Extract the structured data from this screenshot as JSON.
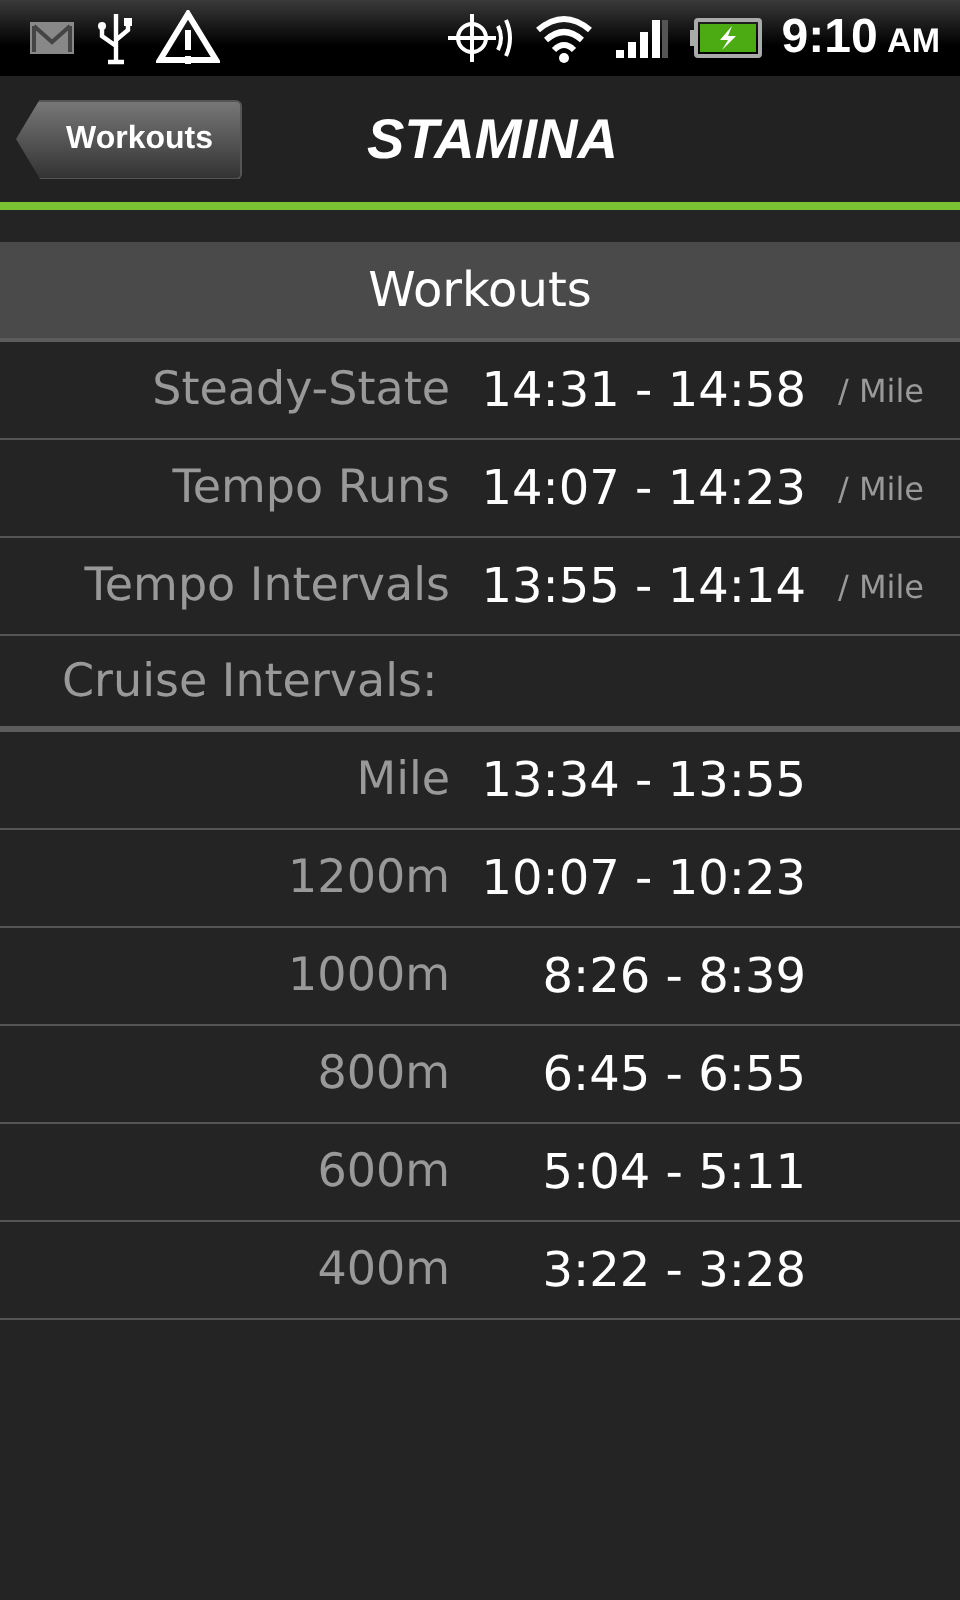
{
  "status_bar": {
    "time": "9:10",
    "ampm": "AM"
  },
  "header": {
    "back_button": "Workouts",
    "title": "STAMINA"
  },
  "section": {
    "title": "Workouts"
  },
  "rows": [
    {
      "kind": "pace",
      "label": "Steady-State",
      "value": "14:31 - 14:58",
      "unit": "/ Mile"
    },
    {
      "kind": "pace",
      "label": "Tempo Runs",
      "value": "14:07 - 14:23",
      "unit": "/ Mile"
    },
    {
      "kind": "pace",
      "label": "Tempo Intervals",
      "value": "13:55 - 14:14",
      "unit": "/ Mile"
    },
    {
      "kind": "heading",
      "label": "Cruise Intervals:"
    },
    {
      "kind": "interval",
      "label": "Mile",
      "value": "13:34 - 13:55"
    },
    {
      "kind": "interval",
      "label": "1200m",
      "value": "10:07 - 10:23"
    },
    {
      "kind": "interval",
      "label": "1000m",
      "value": "8:26 - 8:39"
    },
    {
      "kind": "interval",
      "label": "800m",
      "value": "6:45 - 6:55"
    },
    {
      "kind": "interval",
      "label": "600m",
      "value": "5:04 - 5:11"
    },
    {
      "kind": "interval",
      "label": "400m",
      "value": "3:22 - 3:28"
    }
  ]
}
